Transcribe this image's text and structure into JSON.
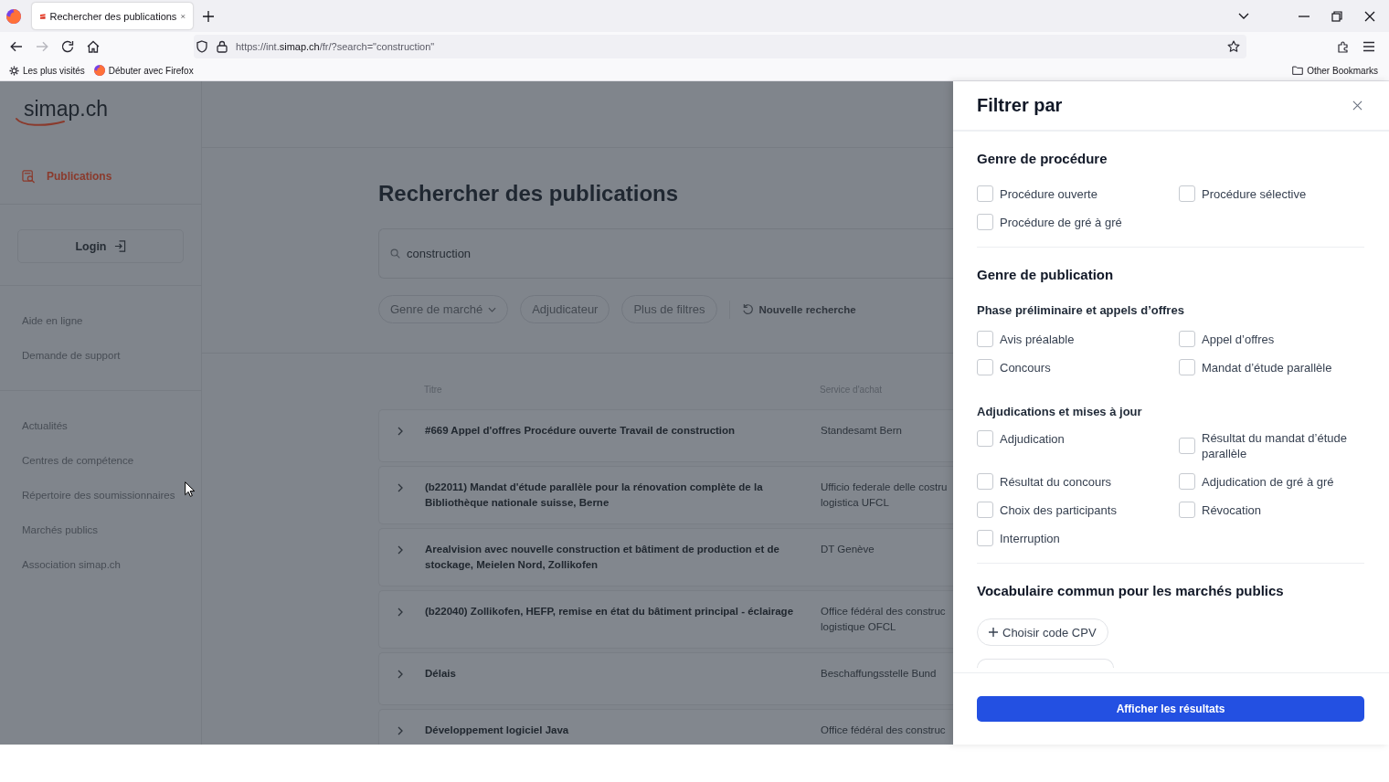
{
  "browser": {
    "tabs": [
      {
        "title": "Rechercher des publications",
        "selected": true
      }
    ],
    "nav_buttons": [
      {
        "kind": "back",
        "disabled": false
      },
      {
        "kind": "forward",
        "disabled": true
      },
      {
        "kind": "reload",
        "disabled": false
      },
      {
        "kind": "home",
        "disabled": false
      }
    ],
    "url": {
      "host_prefix": "https://int.",
      "host": "simap.ch",
      "path": "/fr/?search=\"construction\""
    },
    "bookmarks": [
      {
        "kind": "gear",
        "label": "Les plus visités"
      },
      {
        "kind": "browser",
        "label": "Débuter avec Firefox"
      }
    ],
    "other_bookmarks": "Other Bookmarks"
  },
  "sidebar": {
    "logo": "simap.ch",
    "nav": [
      {
        "label": "Publications",
        "selected": true
      }
    ],
    "login": "Login",
    "link_groups": [
      [
        "Aide en ligne",
        "Demande de support"
      ],
      [
        "Actualités",
        "Centres de compétence",
        "Répertoire des soumissionnaires",
        "Marchés publics",
        "Association simap.ch"
      ]
    ]
  },
  "main": {
    "title": "Rechercher des publications",
    "search": {
      "value": "construction"
    },
    "filters": [
      {
        "label": "Genre de marché",
        "dropdown": true
      },
      {
        "label": "Adjudicateur",
        "dropdown": false
      },
      {
        "label": "Plus de filtres",
        "dropdown": false
      }
    ],
    "reset": "Nouvelle recherche",
    "table": {
      "columns": [
        "Titre",
        "Service d'achat"
      ],
      "rows": [
        {
          "title": "#669 Appel d'offres Procédure ouverte Travail de construction",
          "service": "Standesamt Bern"
        },
        {
          "title": "(b22011) Mandat d'étude parallèle pour la rénovation complète de la Bibliothèque nationale suisse, Berne",
          "service": "Ufficio federale delle costru\nlogistica UFCL"
        },
        {
          "title": "Arealvision avec nouvelle construction et bâtiment de production et de stockage, Meielen Nord, Zollikofen",
          "service": "DT Genève"
        },
        {
          "title": "(b22040) Zollikofen, HEFP, remise en état du bâtiment principal - éclairage",
          "service": "Office fédéral des construc\nlogistique OFCL"
        },
        {
          "title": "Délais",
          "service": "Beschaffungsstelle Bund"
        },
        {
          "title": "Développement logiciel Java",
          "service": "Office fédéral des construc"
        }
      ]
    }
  },
  "filter_panel": {
    "title": "Filtrer par",
    "sections": [
      {
        "title": "Genre de procédure",
        "groups": [
          {
            "options": [
              {
                "label": "Procédure ouverte",
                "checked": false
              },
              {
                "label": "Procédure sélective",
                "checked": false
              },
              {
                "label": "Procédure de gré à gré",
                "checked": false
              }
            ]
          }
        ]
      },
      {
        "title": "Genre de publication",
        "groups": [
          {
            "subtitle": "Phase préliminaire et appels d’offres",
            "options": [
              {
                "label": "Avis préalable",
                "checked": false
              },
              {
                "label": "Appel d’offres",
                "checked": false
              },
              {
                "label": "Concours",
                "checked": false
              },
              {
                "label": "Mandat d’étude parallèle",
                "checked": false
              }
            ]
          },
          {
            "subtitle": "Adjudications et mises à jour",
            "options": [
              {
                "label": "Adjudication",
                "checked": false
              },
              {
                "label": "Résultat du mandat d’étude parallèle",
                "checked": false
              },
              {
                "label": "Résultat du concours",
                "checked": false
              },
              {
                "label": "Adjudication de gré à gré",
                "checked": false
              },
              {
                "label": "Choix des participants",
                "checked": false
              },
              {
                "label": "Révocation",
                "checked": false
              },
              {
                "label": "Interruption",
                "checked": false
              }
            ]
          }
        ]
      },
      {
        "title": "Vocabulaire commun pour les marchés publics",
        "buttons": [
          {
            "kind": "full",
            "label": "Choisir code CPV"
          },
          {
            "kind": "cut_off"
          }
        ]
      }
    ],
    "submit": "Afficher les résultats"
  }
}
